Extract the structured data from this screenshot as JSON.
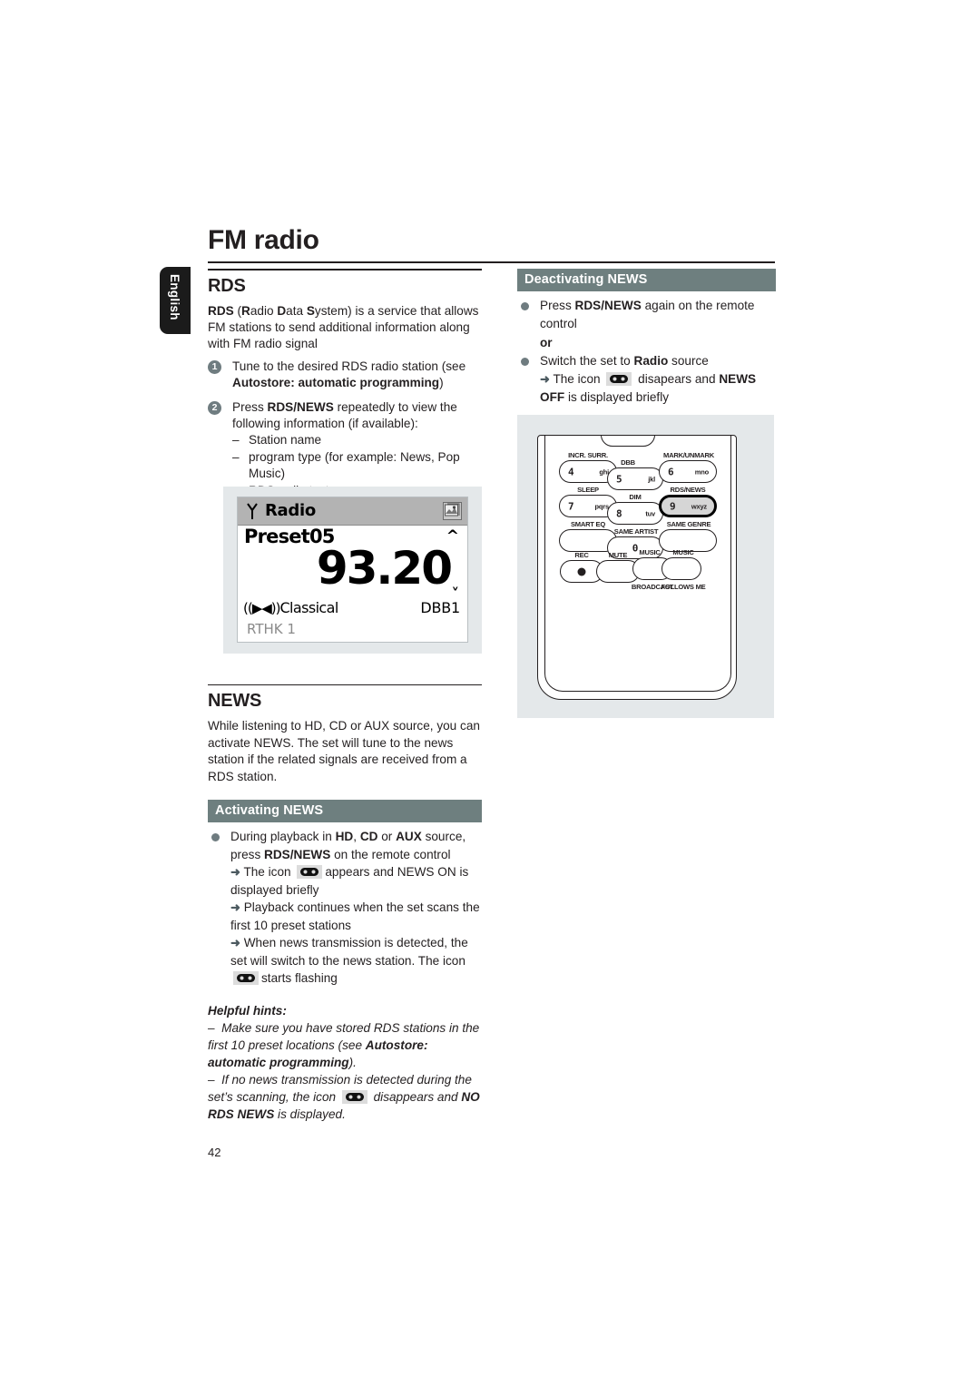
{
  "page": {
    "title": "FM radio",
    "number": "42",
    "language_tab": "English"
  },
  "left_column": {
    "rds": {
      "heading": "RDS",
      "intro_parts": {
        "p1": "RDS",
        "p2": " (",
        "p3": "R",
        "p4": "adio ",
        "p5": "D",
        "p6": "ata ",
        "p7": "S",
        "p8": "ystem) is a service that allows FM stations to send additional information along with FM radio signal"
      },
      "steps": [
        {
          "number": "1",
          "text_before": "Tune to the desired RDS radio station (see ",
          "bold": "Autostore: automatic programming",
          "text_after": ")"
        },
        {
          "number": "2",
          "text_before": "Press ",
          "bold": "RDS/NEWS",
          "text_after": " repeatedly to view the following information (if available):"
        }
      ],
      "sub_items": [
        "Station name",
        "program type (for example: News, Pop Music)",
        "RDS radio text"
      ]
    },
    "lcd": {
      "source_label": "Radio",
      "preset": "Preset05",
      "frequency": "93.20",
      "program_type": "Classical",
      "dbb": "DBB1",
      "station_name": "RTHK 1",
      "antenna_icon": "antenna-icon",
      "corner_icon": "album-art-icon",
      "speaker_icon": "speaker-icon",
      "up_arrow": "˄",
      "down_arrow": "˅"
    },
    "news": {
      "heading": "NEWS",
      "intro": "While listening to HD, CD or AUX source, you can activate NEWS. The set will tune to the news station if the related signals are received from a RDS station.",
      "activating_header": "Activating NEWS",
      "bullet": {
        "t1": "During playback in ",
        "b1": "HD",
        "t2": ", ",
        "b2": "CD",
        "t3": " or ",
        "b3": "AUX",
        "t4": " source, press ",
        "b4": "RDS/NEWS",
        "t5": " on the remote control"
      },
      "arrows": [
        {
          "before": "The icon ",
          "icon": "news-icon",
          "after": "appears and NEWS ON is displayed briefly"
        },
        {
          "before": "Playback continues when the set scans the first 10 preset stations",
          "icon": null,
          "after": ""
        },
        {
          "before": "When news transmission is detected, the set will switch to the news station. The icon ",
          "icon": "news-icon",
          "after": "starts flashing"
        }
      ]
    },
    "helpful_hints": {
      "heading": "Helpful hints:",
      "hint1": {
        "t1": "Make sure you have stored RDS stations in the first 10 preset locations (see ",
        "b1": "Autostore: automatic programming",
        "t2": ")."
      },
      "hint2": {
        "t1": "If no news transmission is detected during the set’s scanning,  the icon ",
        "icon": "news-icon",
        "t2": " disappears and ",
        "b1": "NO RDS NEWS",
        "t3": " is displayed."
      }
    }
  },
  "right_column": {
    "deactivating": {
      "header": "Deactivating NEWS",
      "bullet1": {
        "t1": "Press ",
        "b1": "RDS/NEWS",
        "t2": " again on the remote control"
      },
      "or": "or",
      "bullet2": {
        "t1": "Switch the set to ",
        "b1": "Radio",
        "t2": " source"
      },
      "arrow": {
        "t1": "The icon ",
        "icon": "news-icon",
        "t2": " disapears and ",
        "b1": "NEWS OFF",
        "t3": " is displayed briefly"
      }
    },
    "remote": {
      "name": "remote-control-diagram",
      "buttons": [
        {
          "id": "btn-4",
          "label": "INCR. SURR.",
          "label_pos": "above",
          "digit": "4",
          "letters": "ghi",
          "selected": false
        },
        {
          "id": "btn-5",
          "label": "DBB",
          "label_pos": "above",
          "digit": "5",
          "letters": "jkl",
          "selected": false
        },
        {
          "id": "btn-6",
          "label": "MARK/UNMARK",
          "label_pos": "above",
          "digit": "6",
          "letters": "mno",
          "selected": false
        },
        {
          "id": "btn-7",
          "label": "SLEEP",
          "label_pos": "above",
          "digit": "7",
          "letters": "pqrs",
          "selected": false
        },
        {
          "id": "btn-8",
          "label": "DIM",
          "label_pos": "above",
          "digit": "8",
          "letters": "tuv",
          "selected": false
        },
        {
          "id": "btn-9",
          "label": "RDS/NEWS",
          "label_pos": "above",
          "digit": "9",
          "letters": "wxyz",
          "selected": true
        },
        {
          "id": "btn-smart-eq",
          "label": "SMART EQ",
          "label_pos": "above",
          "digit": "",
          "letters": "",
          "selected": false
        },
        {
          "id": "btn-0",
          "label": "SAME ARTIST",
          "label_pos": "above",
          "digit": "0",
          "letters": "",
          "selected": false
        },
        {
          "id": "btn-same-genre",
          "label": "SAME GENRE",
          "label_pos": "above",
          "digit": "",
          "letters": "",
          "selected": false
        },
        {
          "id": "btn-rec",
          "label": "REC",
          "label_pos": "above",
          "digit": "",
          "letters": "",
          "selected": false
        },
        {
          "id": "btn-mute",
          "label": "MUTE",
          "label_pos": "above",
          "digit": "",
          "letters": "",
          "selected": false
        },
        {
          "id": "btn-music-broadcast",
          "label": "MUSIC",
          "sublabel": "BROADCAST",
          "label_pos": "above",
          "digit": "",
          "letters": "",
          "selected": false
        },
        {
          "id": "btn-music-follows-me",
          "label": "MUSIC",
          "sublabel": "FOLLOWS ME",
          "label_pos": "above",
          "digit": "",
          "letters": "",
          "selected": false
        }
      ]
    }
  },
  "colors": {
    "header_bar": "#6e7f7f",
    "bullet": "#6f7c80",
    "figure_bg": "#e4e8ea",
    "text": "#231f20",
    "tab_bg": "#1b1b1b"
  }
}
